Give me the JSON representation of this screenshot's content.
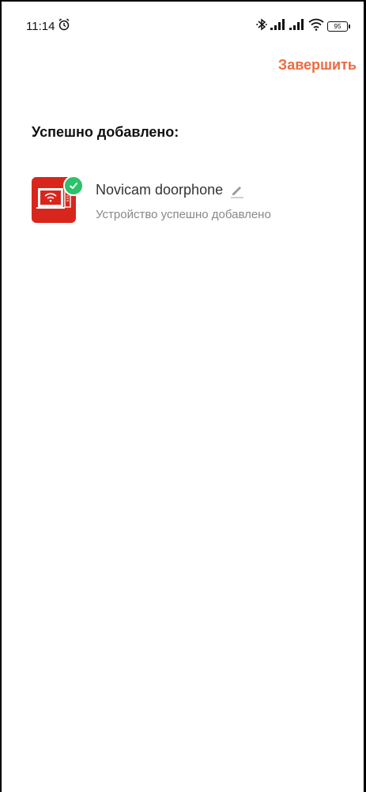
{
  "status_bar": {
    "time": "11:14",
    "battery": "95"
  },
  "header": {
    "finish_label": "Завершить"
  },
  "main": {
    "section_title": "Успешно добавлено:",
    "device": {
      "name": "Novicam doorphone",
      "status": "Устройство успешно добавлено"
    }
  },
  "colors": {
    "accent": "#ee6a3f",
    "device_icon_bg": "#d9261c",
    "success": "#2bc26a"
  }
}
